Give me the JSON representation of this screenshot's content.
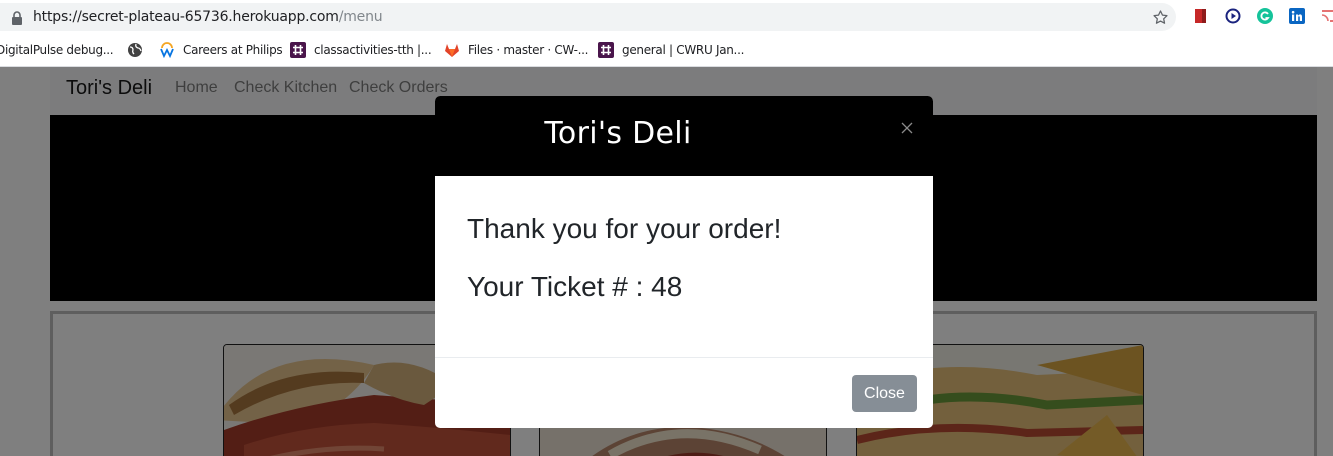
{
  "browser": {
    "url_host": "https://secret-plateau-65736.herokuapp.com",
    "url_path": "/menu",
    "bookmarks": [
      {
        "label": "DigitalPulse debug...",
        "icon": "none"
      },
      {
        "label": "",
        "icon": "globe-icon"
      },
      {
        "label": "Careers at Philips",
        "icon": "workday-icon"
      },
      {
        "label": "classactivities-tth |...",
        "icon": "slack-icon"
      },
      {
        "label": "Files · master · CW-...",
        "icon": "gitlab-icon"
      },
      {
        "label": "general | CWRU Jan...",
        "icon": "slack-icon"
      }
    ],
    "extensions": [
      "bookmark-extension-icon",
      "play-extension-icon",
      "grammarly-icon",
      "linkedin-icon",
      "cast-icon"
    ]
  },
  "site": {
    "brand": "Tori's Deli",
    "nav": [
      "Home",
      "Check Kitchen",
      "Check Orders"
    ]
  },
  "modal": {
    "title": "Tori's Deli",
    "message": "Thank you for your order!",
    "ticket": "Your Ticket # : 48",
    "close_label": "Close"
  },
  "colors": {
    "header_bg": "#000000",
    "close_button_bg": "#868e96",
    "backdrop": "rgba(0,0,0,0.5)"
  }
}
